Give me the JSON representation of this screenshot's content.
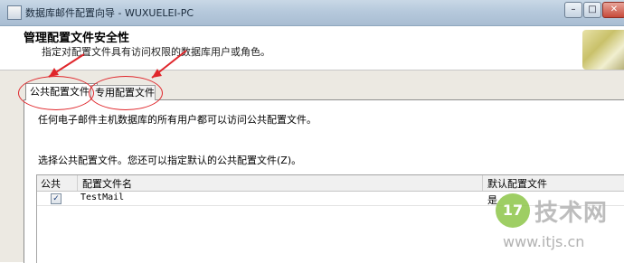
{
  "window": {
    "title": "数据库邮件配置向导 - WUXUELEI-PC",
    "minimize_glyph": "–",
    "maximize_glyph": "□",
    "close_glyph": "✕"
  },
  "header": {
    "title": "管理配置文件安全性",
    "subtitle": "指定对配置文件具有访问权限的数据库用户或角色。"
  },
  "tabs": [
    {
      "label": "公共配置文件",
      "selected": true
    },
    {
      "label": "专用配置文件",
      "selected": false
    }
  ],
  "content": {
    "description": "任何电子邮件主机数据库的所有用户都可以访问公共配置文件。",
    "instruction": "选择公共配置文件。您还可以指定默认的公共配置文件(Z)。"
  },
  "grid": {
    "columns": [
      "公共",
      "配置文件名",
      "默认配置文件"
    ],
    "rows": [
      {
        "public": true,
        "public_mark": "✓",
        "name": "TestMail",
        "default": "是"
      }
    ]
  },
  "watermark": {
    "logo": "17",
    "name": "技术网",
    "url": "www.itjs.cn"
  },
  "annotation_color": "#e0262b",
  "icons": [
    "app-icon",
    "minimize-icon",
    "maximize-icon",
    "close-icon",
    "wizard-art-icon",
    "checkbox-checked-icon"
  ]
}
